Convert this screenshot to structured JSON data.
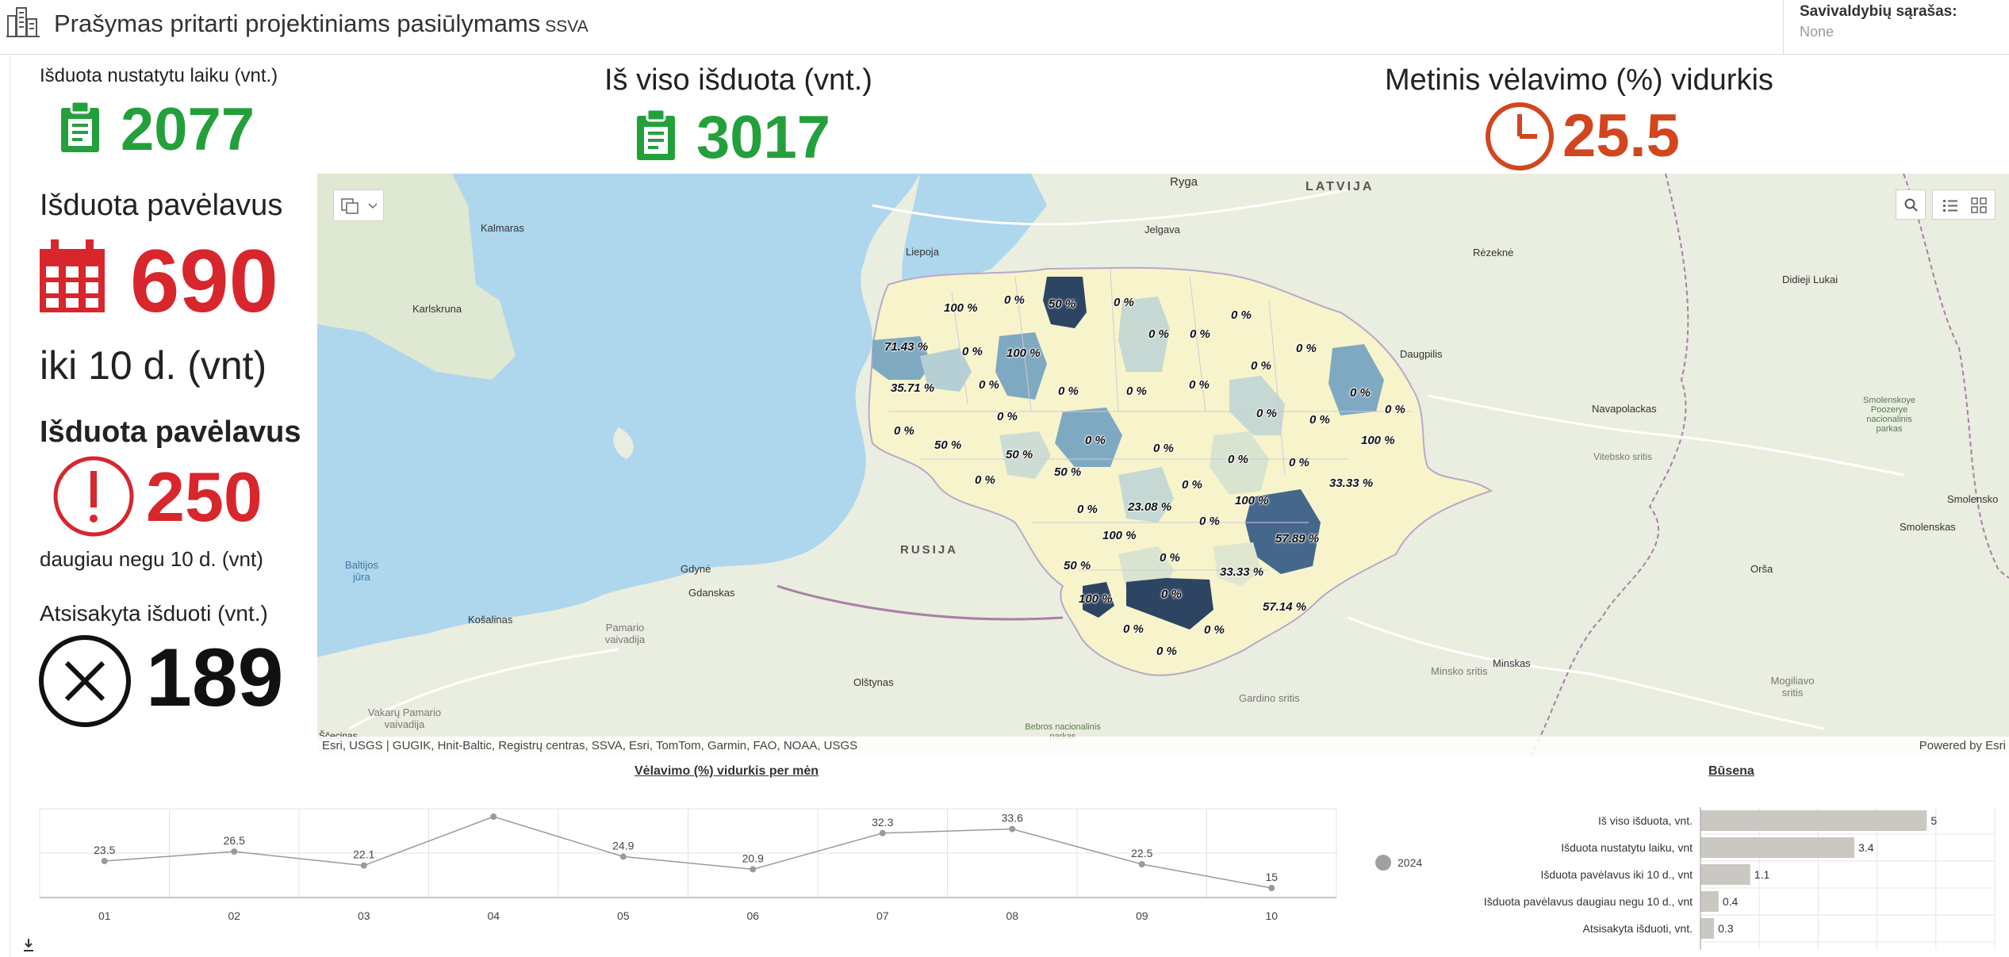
{
  "header": {
    "title": "Prašymas pritarti projektiniams pasiūlymams",
    "subtitle": "SSVA",
    "selector_label": "Savivaldybių sąrašas:",
    "selector_value": "None"
  },
  "kpis": {
    "on_time": {
      "label": "Išduota nustatytu laiku (vnt.)",
      "value": "2077",
      "icon": "clipboard-icon",
      "color": "#23a03c"
    },
    "total": {
      "label": "Iš viso išduota (vnt.)",
      "value": "3017",
      "icon": "clipboard-icon",
      "color": "#23a03c"
    },
    "delay_avg": {
      "label": "Metinis vėlavimo (%) vidurkis",
      "value": "25.5",
      "icon": "clock-icon",
      "color": "#d2461e"
    },
    "late_10": {
      "label": "Išduota pavėlavus",
      "value": "690",
      "sublabel": "iki 10 d. (vnt)",
      "icon": "calendar-icon",
      "color": "#d7262c"
    },
    "late_more": {
      "label": "Išduota pavėlavus",
      "value": "250",
      "sublabel": "daugiau negu 10 d. (vnt)",
      "icon": "exclamation-icon",
      "color": "#d7262c"
    },
    "refused": {
      "label": "Atsisakyta išduoti (vnt.)",
      "value": "189",
      "icon": "cross-circle-icon",
      "color": "#111111"
    }
  },
  "map": {
    "place_labels": [
      {
        "text": "Ryga",
        "cls": "city"
      },
      {
        "text": "LATVIJA",
        "cls": "country"
      },
      {
        "text": "Kalmaras",
        "cls": "city"
      },
      {
        "text": "Liepoja",
        "cls": "city"
      },
      {
        "text": "Jelgava",
        "cls": "city"
      },
      {
        "text": "Rėzeknė",
        "cls": "city"
      },
      {
        "text": "Didieji Lukai",
        "cls": "city"
      },
      {
        "text": "Karlskruna",
        "cls": "city"
      },
      {
        "text": "Daugpilis",
        "cls": "city"
      },
      {
        "text": "Navapolackas",
        "cls": "city"
      },
      {
        "text": "Smolenskoye Poozerye nacionalinis parkas",
        "cls": "park"
      },
      {
        "text": "Vitebsko sritis",
        "cls": "region"
      },
      {
        "text": "Smolensko",
        "cls": "city"
      },
      {
        "text": "Smolenskas",
        "cls": "city"
      },
      {
        "text": "RUSIJA",
        "cls": "country"
      },
      {
        "text": "Baltijos jūra",
        "cls": "sea"
      },
      {
        "text": "Gdynė",
        "cls": "city"
      },
      {
        "text": "Gdanskas",
        "cls": "city"
      },
      {
        "text": "Orša",
        "cls": "city"
      },
      {
        "text": "Košalinas",
        "cls": "city"
      },
      {
        "text": "Pamario vaivadija",
        "cls": "region"
      },
      {
        "text": "Minsko sritis",
        "cls": "region"
      },
      {
        "text": "Minskas",
        "cls": "city"
      },
      {
        "text": "Mogiliavo sritis",
        "cls": "region"
      },
      {
        "text": "Olštynas",
        "cls": "city"
      },
      {
        "text": "Gardino sritis",
        "cls": "region"
      },
      {
        "text": "Vakarų Pamario vaivadija",
        "cls": "region"
      },
      {
        "text": "Bebros nacionalinis parkas",
        "cls": "park"
      },
      {
        "text": "Ščecinas",
        "cls": "city"
      }
    ],
    "percent_labels": [
      "50 %",
      "0 %",
      "0 %",
      "0 %",
      "100 %",
      "71.43 %",
      "0 %",
      "100 %",
      "0 %",
      "0 %",
      "0 %",
      "0 %",
      "0 %",
      "35.71 %",
      "0 %",
      "0 %",
      "0 %",
      "0 %",
      "0 %",
      "0 %",
      "0 %",
      "0 %",
      "50 %",
      "0 %",
      "50 %",
      "0 %",
      "100 %",
      "0 %",
      "0 %",
      "50 %",
      "0 %",
      "33.33 %",
      "0 %",
      "0 %",
      "23.08 %",
      "100 %",
      "0 %",
      "100 %",
      "57.89 %",
      "50 %",
      "0 %",
      "0 %",
      "33.33 %",
      "100 %",
      "0 %",
      "57.14 %",
      "0 %",
      "0 %",
      "0 %"
    ],
    "attribution": "Esri, USGS | GUGIK, Hnit-Baltic, Registrų centras, SSVA, Esri, TomTom, Garmin, FAO, NOAA, USGS",
    "powered_by": "Powered by Esri"
  },
  "line_chart": {
    "title": "Vėlavimo (%) vidurkis per mėn",
    "download_icon": "download-icon"
  },
  "bar_chart": {
    "title": "Būsena",
    "legend": "2024",
    "legend_color": "#a0a0a0"
  },
  "chart_data": [
    {
      "type": "line",
      "title": "Vėlavimo (%) vidurkis per mėn",
      "categories": [
        "01",
        "02",
        "03",
        "04",
        "05",
        "06",
        "07",
        "08",
        "09",
        "10"
      ],
      "values": [
        23.5,
        26.5,
        22.1,
        37.5,
        24.9,
        20.9,
        32.3,
        33.6,
        22.5,
        15
      ],
      "data_labels": [
        "23.5",
        "26.5",
        "22.1",
        "",
        "24.9",
        "20.9",
        "32.3",
        "33.6",
        "22.5",
        "15"
      ],
      "ylim": [
        12,
        40
      ],
      "grid": true,
      "color": "#9a9a9a"
    },
    {
      "type": "bar",
      "orientation": "horizontal",
      "title": "Būsena",
      "categories": [
        "Iš viso išduota, vnt.",
        "Išduota nustatytu laiku, vnt",
        "Išduota pavėlavus iki 10 d., vnt",
        "Išduota pavėlavus daugiau negu 10 d., vnt",
        "Atsisakyta išduoti, vnt."
      ],
      "series": [
        {
          "name": "2024",
          "values": [
            5,
            3.4,
            1.1,
            0.4,
            0.3
          ]
        }
      ],
      "xlim": [
        0,
        6.5
      ],
      "color": "#cbc8c4"
    }
  ]
}
